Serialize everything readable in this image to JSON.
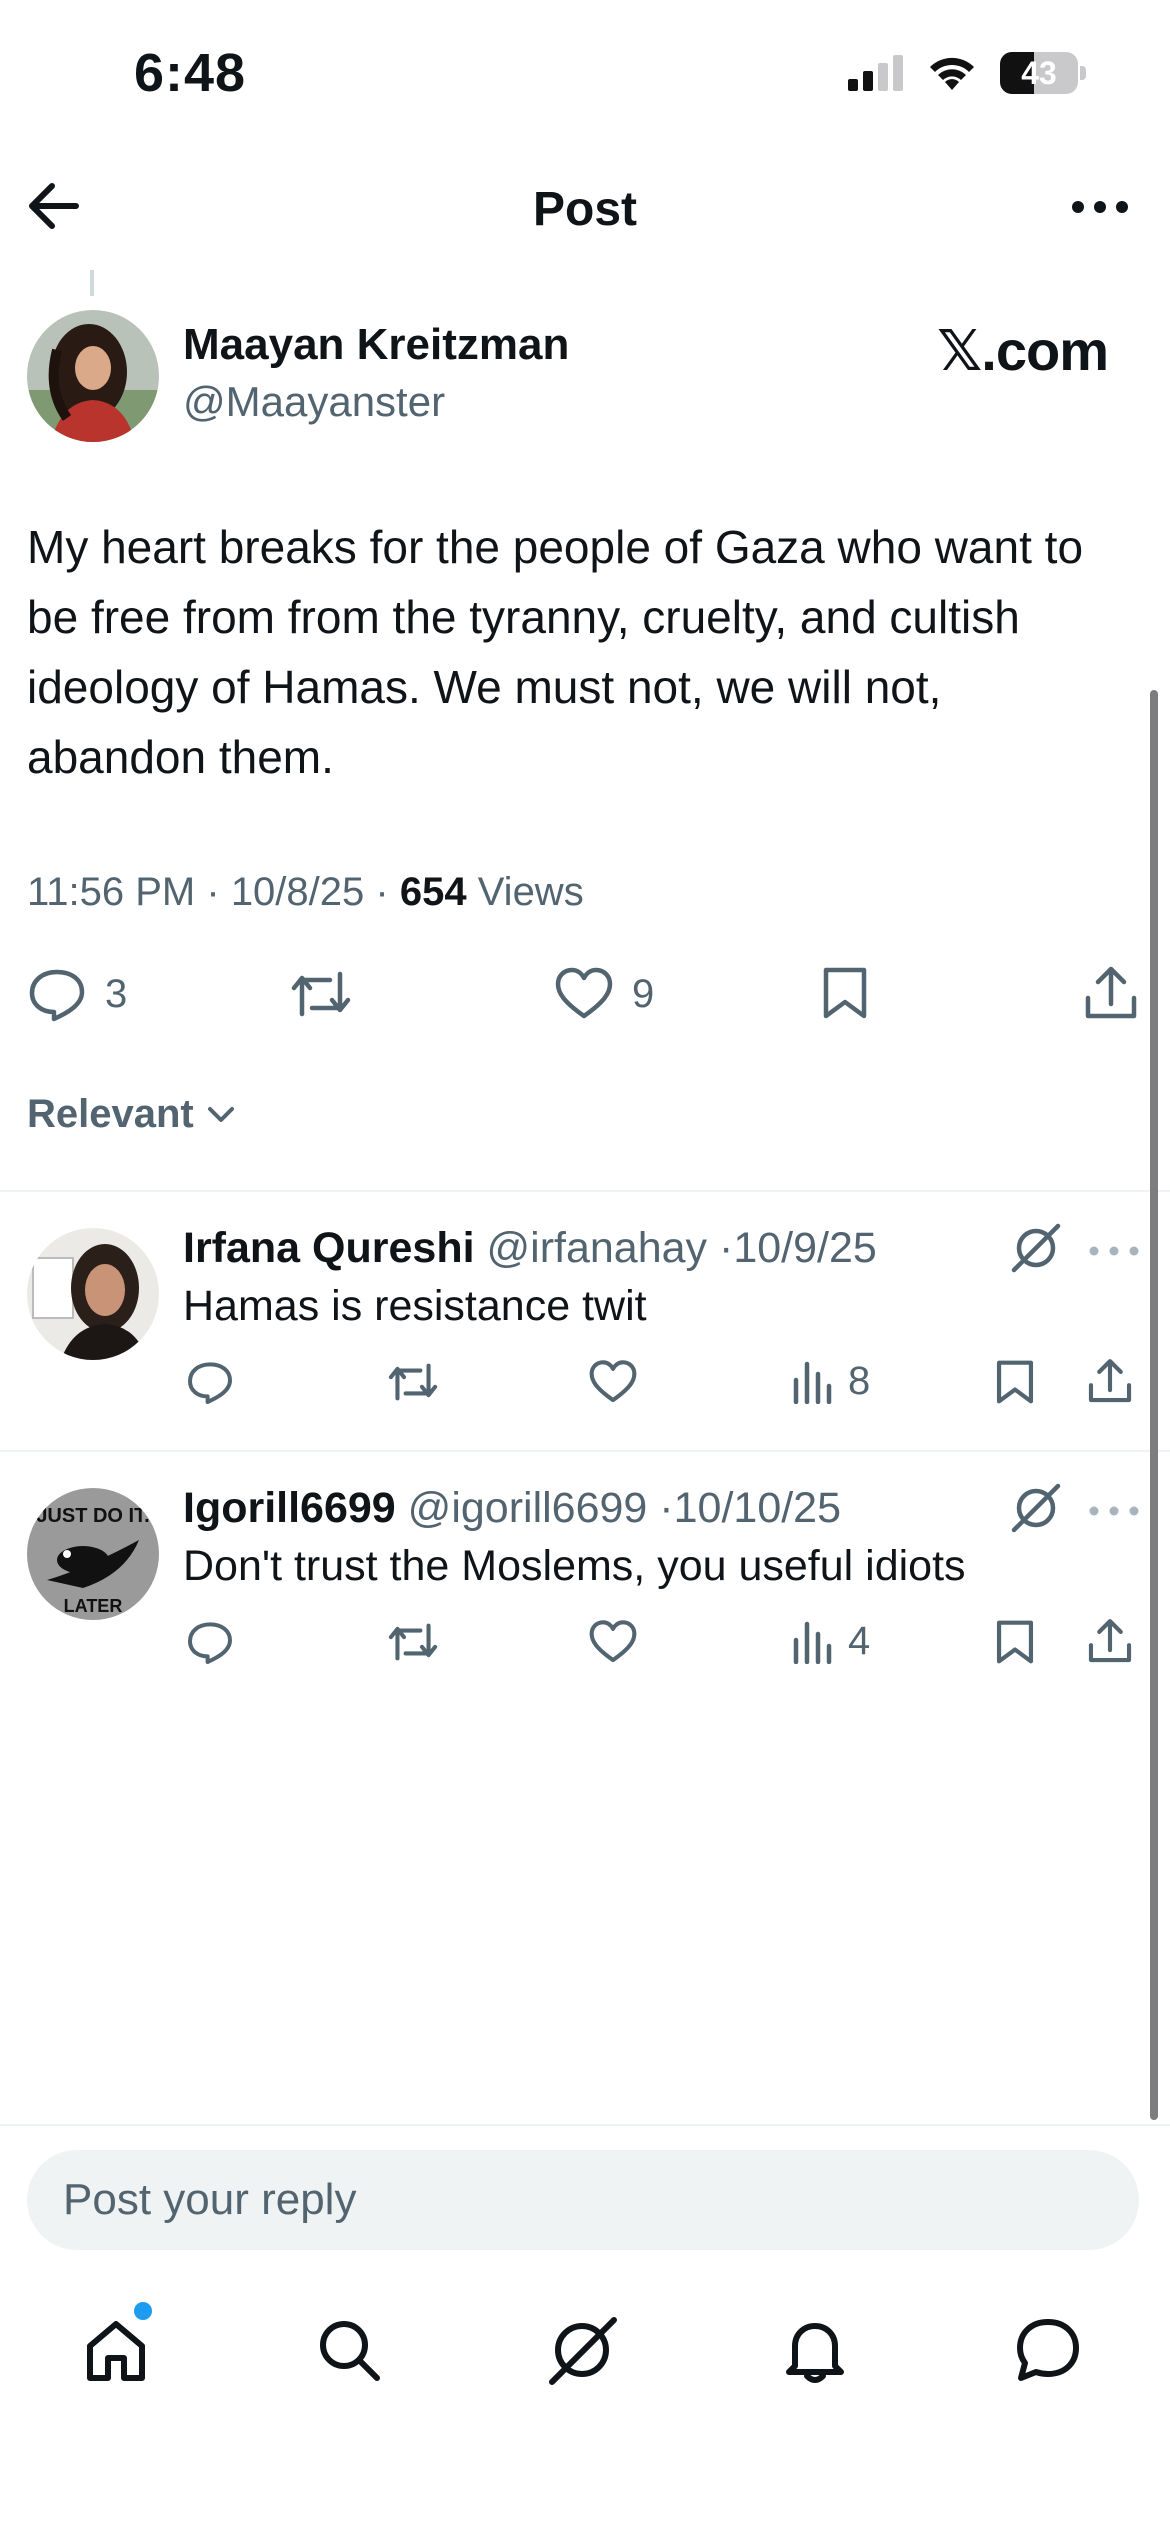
{
  "status_bar": {
    "time": "6:48",
    "battery_percent": "43",
    "battery_level": 0.43
  },
  "header": {
    "title": "Post"
  },
  "post": {
    "author_name": "Maayan Kreitzman",
    "author_handle": "@Maayanster",
    "brand": "𝕏.com",
    "text": "My heart breaks for the people of Gaza who want to be free from from the tyranny, cruelty, and cultish ideology of Hamas. We must not, we will not, abandon them.",
    "time": "11:56 PM",
    "date": "10/8/25",
    "views_count": "654",
    "views_label": "Views",
    "replies_count": "3",
    "likes_count": "9"
  },
  "sort": {
    "label": "Relevant"
  },
  "replies": [
    {
      "name": "Irfana Qureshi",
      "handle": "@irfanahay",
      "date": "10/9/25",
      "text": "Hamas is resistance twit",
      "views": "8"
    },
    {
      "name": "Igorill6699",
      "handle": "@igorill6699",
      "date": "10/10/25",
      "text": "Don't trust the Moslems, you useful idiots",
      "views": "4",
      "avatar_text_top": "JUST DO IT.",
      "avatar_text_bottom": "LATER"
    }
  ],
  "composer": {
    "placeholder": "Post your reply"
  },
  "tabbar": {
    "items": [
      "home-icon",
      "search-icon",
      "grok-icon",
      "notifications-icon",
      "messages-icon"
    ],
    "home_has_badge": true,
    "badge_color": "#1d9bf0"
  },
  "colors": {
    "text": "#0f1419",
    "secondary": "#536471",
    "divider": "#eff3f4",
    "accent": "#1d9bf0"
  }
}
